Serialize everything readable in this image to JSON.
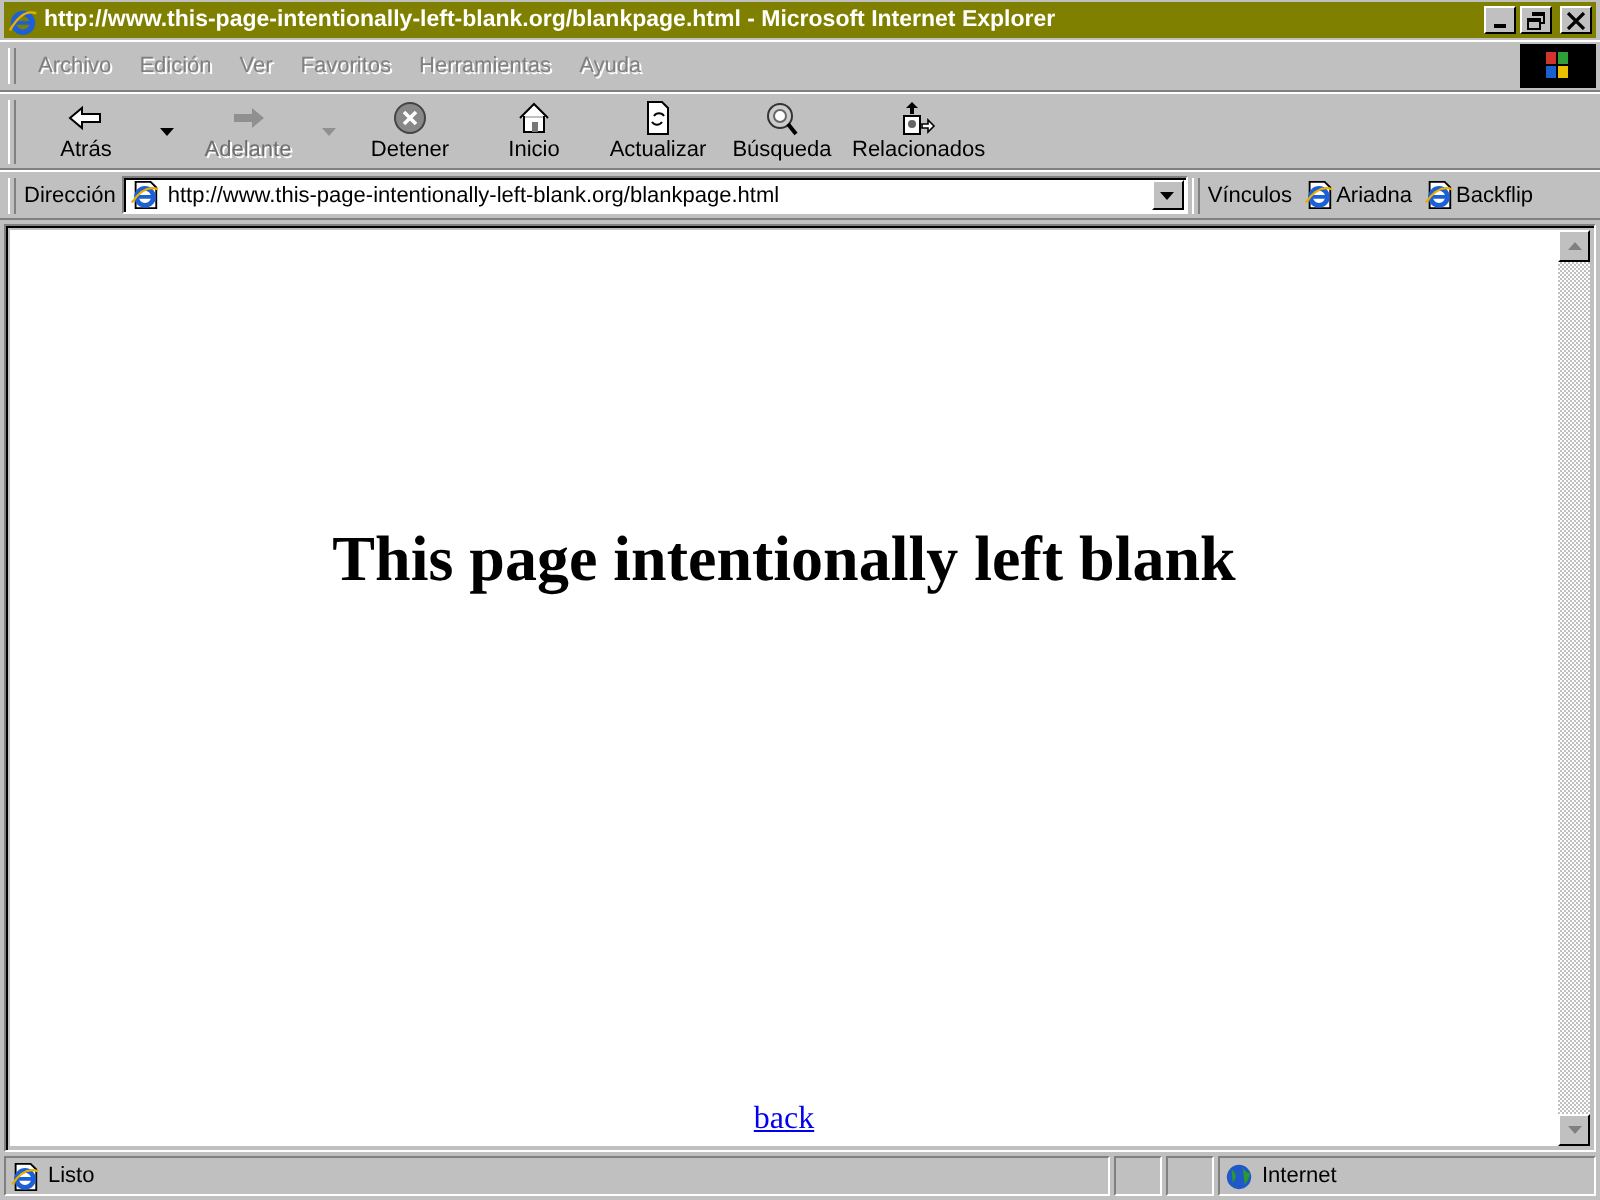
{
  "window": {
    "title": "http://www.this-page-intentionally-left-blank.org/blankpage.html - Microsoft Internet Explorer"
  },
  "menu": [
    {
      "label": "Archivo",
      "disabled": true
    },
    {
      "label": "Edición",
      "disabled": true
    },
    {
      "label": "Ver",
      "disabled": true
    },
    {
      "label": "Favoritos",
      "disabled": true
    },
    {
      "label": "Herramientas",
      "disabled": true
    },
    {
      "label": "Ayuda",
      "disabled": true
    }
  ],
  "toolbar": [
    {
      "kind": "back",
      "label": "Atrás",
      "disabled": false,
      "dropdown": true
    },
    {
      "kind": "forward",
      "label": "Adelante",
      "disabled": true,
      "dropdown": true
    },
    {
      "kind": "stop",
      "label": "Detener",
      "disabled": false,
      "dropdown": false
    },
    {
      "kind": "home",
      "label": "Inicio",
      "disabled": false,
      "dropdown": false
    },
    {
      "kind": "refresh",
      "label": "Actualizar",
      "disabled": false,
      "dropdown": false
    },
    {
      "kind": "search",
      "label": "Búsqueda",
      "disabled": false,
      "dropdown": false
    },
    {
      "kind": "related",
      "label": "Relacionados",
      "disabled": false,
      "dropdown": false
    }
  ],
  "address": {
    "label": "Dirección",
    "value": "http://www.this-page-intentionally-left-blank.org/blankpage.html"
  },
  "links": {
    "label": "Vínculos",
    "items": [
      "Ariadna",
      "Backflip"
    ]
  },
  "page": {
    "heading": "This page intentionally left blank",
    "link": "back"
  },
  "status_bar": {
    "text": "Listo",
    "zone": "Internet"
  }
}
